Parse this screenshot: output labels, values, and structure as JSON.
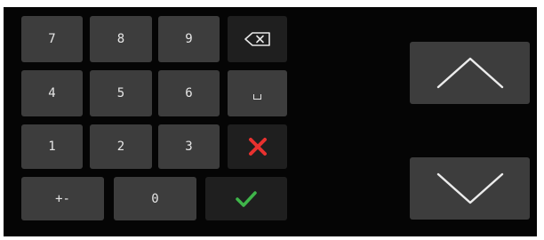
{
  "keypad": {
    "row1": [
      "7",
      "8",
      "9"
    ],
    "row2": [
      "4",
      "5",
      "6"
    ],
    "row3": [
      "1",
      "2",
      "3"
    ],
    "plus_minus": "+-",
    "zero": "0"
  },
  "icons": {
    "backspace": "backspace-icon",
    "space": "space-icon",
    "cancel": "close-icon",
    "confirm": "check-icon",
    "up": "chevron-up-icon",
    "down": "chevron-down-icon"
  },
  "colors": {
    "background": "#050505",
    "key": "#3d3d3d",
    "key_dark": "#1f1f1f",
    "cancel": "#e8312f",
    "confirm": "#3fb54a",
    "text": "#e6e6e6"
  }
}
